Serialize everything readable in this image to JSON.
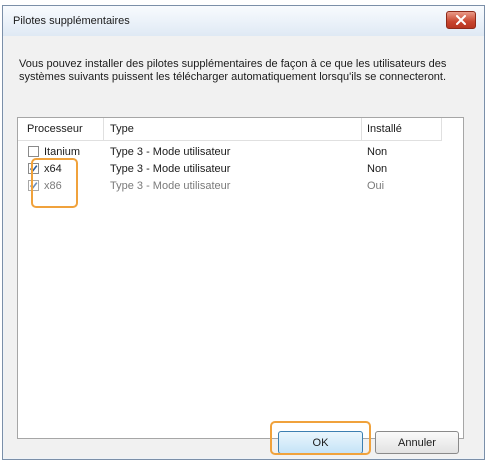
{
  "dialog": {
    "title": "Pilotes supplémentaires",
    "description": "Vous pouvez installer des pilotes supplémentaires de façon à ce que les utilisateurs des systèmes suivants puissent les télécharger automatiquement lorsqu'ils se connecteront.",
    "close_icon": "close-icon"
  },
  "table": {
    "headers": {
      "processor": "Processeur",
      "type": "Type",
      "installed": "Installé"
    },
    "rows": [
      {
        "processor": "Itanium",
        "type": "Type 3 - Mode utilisateur",
        "installed": "Non",
        "checked": false,
        "disabled": false
      },
      {
        "processor": "x64",
        "type": "Type 3 - Mode utilisateur",
        "installed": "Non",
        "checked": true,
        "disabled": false
      },
      {
        "processor": "x86",
        "type": "Type 3 - Mode utilisateur",
        "installed": "Oui",
        "checked": true,
        "disabled": true
      }
    ]
  },
  "buttons": {
    "ok": "OK",
    "cancel": "Annuler"
  },
  "colors": {
    "highlight": "#f0a23c",
    "close_button": "#c8452e"
  }
}
